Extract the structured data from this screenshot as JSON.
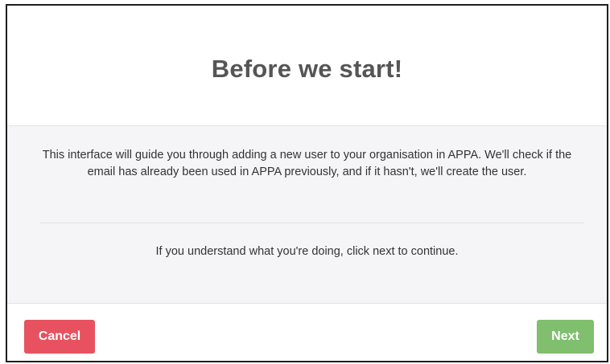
{
  "dialog": {
    "title": "Before we start!",
    "intro_text": "This interface will guide you through adding a new user to your organisation in APPA. We'll check if the email has already been used in APPA previously, and if it hasn't, we'll create the user.",
    "confirm_text": "If you understand what you're doing, click next to continue."
  },
  "footer": {
    "cancel_label": "Cancel",
    "next_label": "Next"
  },
  "colors": {
    "cancel_button": "#e85260",
    "next_button": "#7fbf6e",
    "body_background": "#f5f5f7"
  }
}
